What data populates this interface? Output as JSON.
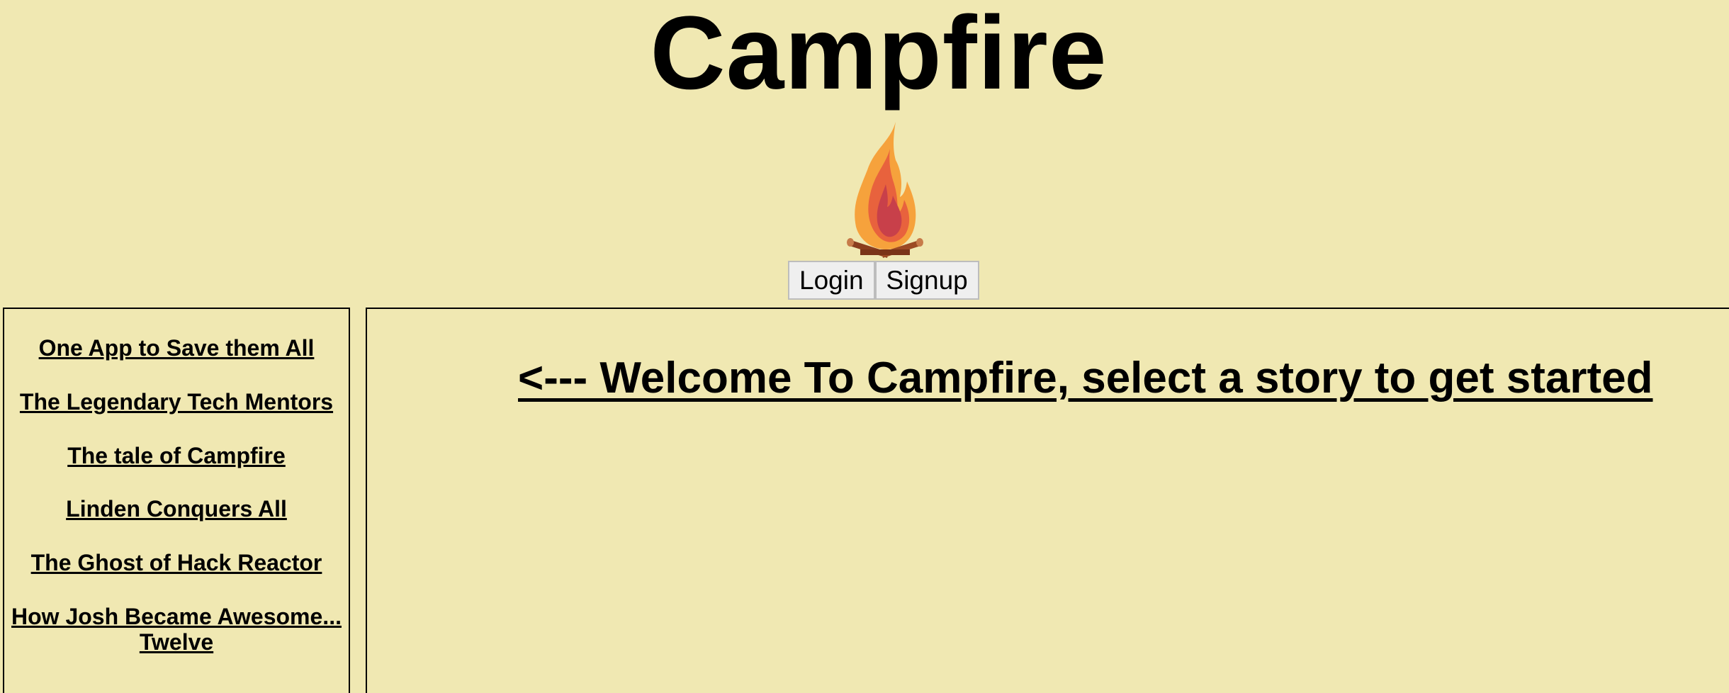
{
  "header": {
    "title": "Campfire",
    "logo_icon": "campfire-icon",
    "login_label": "Login",
    "signup_label": "Signup"
  },
  "sidebar": {
    "stories": [
      {
        "title": "One App to Save them All"
      },
      {
        "title": "The Legendary Tech Mentors"
      },
      {
        "title": "The tale of Campfire"
      },
      {
        "title": "Linden Conquers All"
      },
      {
        "title": "The Ghost of Hack Reactor"
      },
      {
        "title": "How Josh Became Awesome... Twelve"
      }
    ]
  },
  "main": {
    "welcome_text": "<--- Welcome To Campfire, select a story to get started"
  },
  "colors": {
    "background": "#f0e8b2",
    "text": "#000000",
    "button_bg": "#efefef",
    "flame_outer": "#f6a23c",
    "flame_inner": "#d94a3a",
    "logs": "#8a3e1e"
  }
}
